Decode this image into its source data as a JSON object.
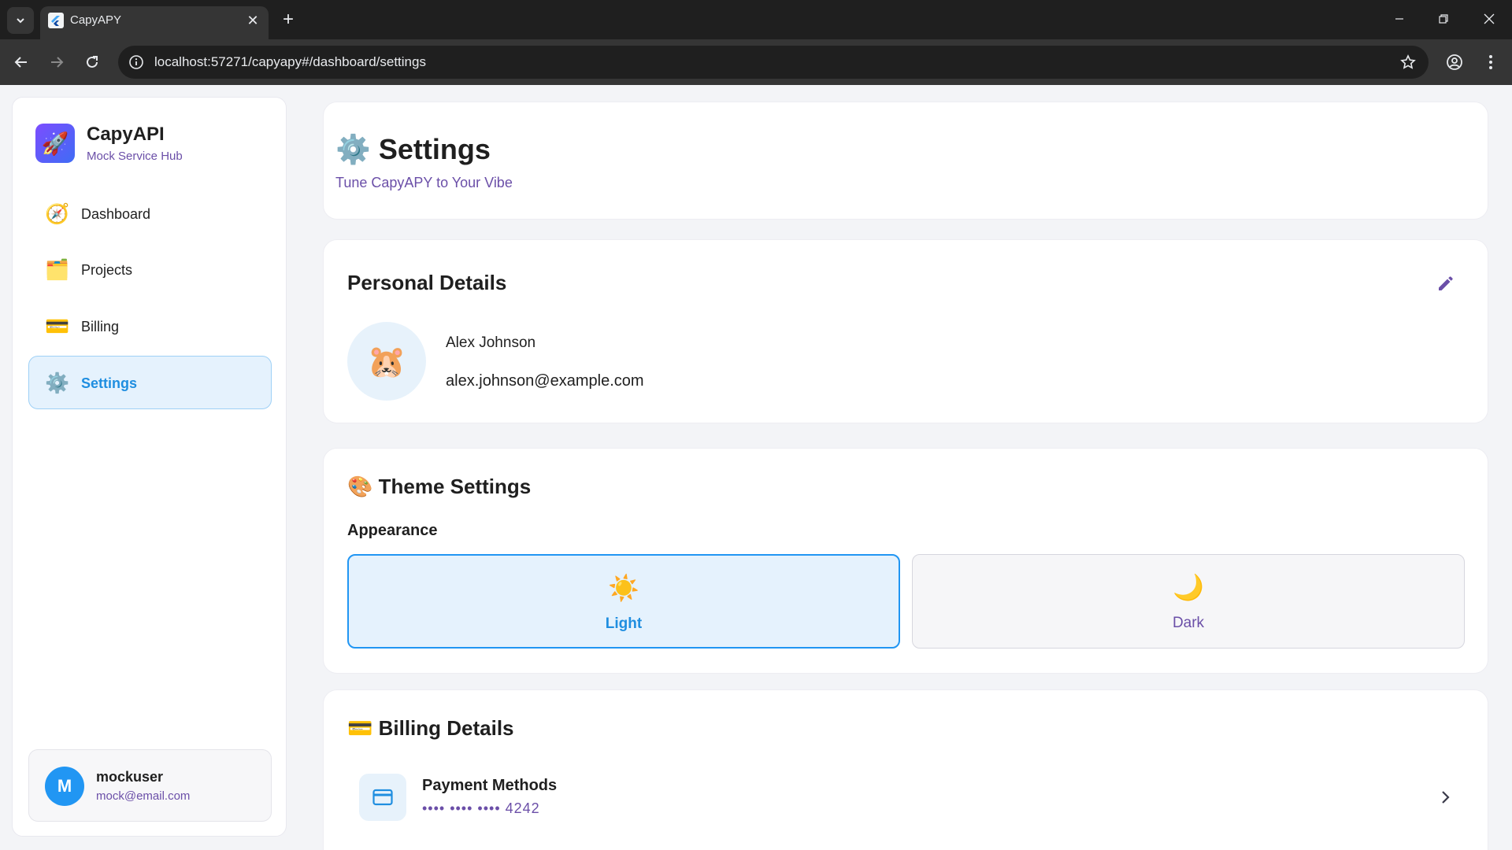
{
  "browser": {
    "tab_title": "CapyAPY",
    "url": "localhost:57271/capyapy#/dashboard/settings"
  },
  "sidebar": {
    "brand_name": "CapyAPI",
    "brand_subtitle": "Mock Service Hub",
    "items": [
      {
        "label": "Dashboard",
        "icon": "compass-icon",
        "glyph": "🧭"
      },
      {
        "label": "Projects",
        "icon": "folder-icon",
        "glyph": "🗂️"
      },
      {
        "label": "Billing",
        "icon": "credit-card-icon",
        "glyph": "💳"
      },
      {
        "label": "Settings",
        "icon": "gear-icon",
        "glyph": "⚙️"
      }
    ],
    "user": {
      "initial": "M",
      "name": "mockuser",
      "email": "mock@email.com"
    }
  },
  "header": {
    "icon": "⚙️",
    "title": "Settings",
    "subtitle": "Tune CapyAPY to Your Vibe"
  },
  "personal": {
    "title": "Personal Details",
    "avatar": "🐹",
    "name": "Alex Johnson",
    "email": "alex.johnson@example.com"
  },
  "theme": {
    "title": "🎨 Theme Settings",
    "section_label": "Appearance",
    "options": [
      {
        "label": "Light",
        "icon": "☀️",
        "selected": true
      },
      {
        "label": "Dark",
        "icon": "🌙",
        "selected": false
      }
    ]
  },
  "billing": {
    "title": "💳 Billing Details",
    "payment_title": "Payment Methods",
    "payment_card": "•••• •••• •••• 4242"
  },
  "colors": {
    "accent_blue": "#2196f3",
    "accent_purple": "#6b4fa8",
    "active_bg": "#e5f2fd"
  }
}
